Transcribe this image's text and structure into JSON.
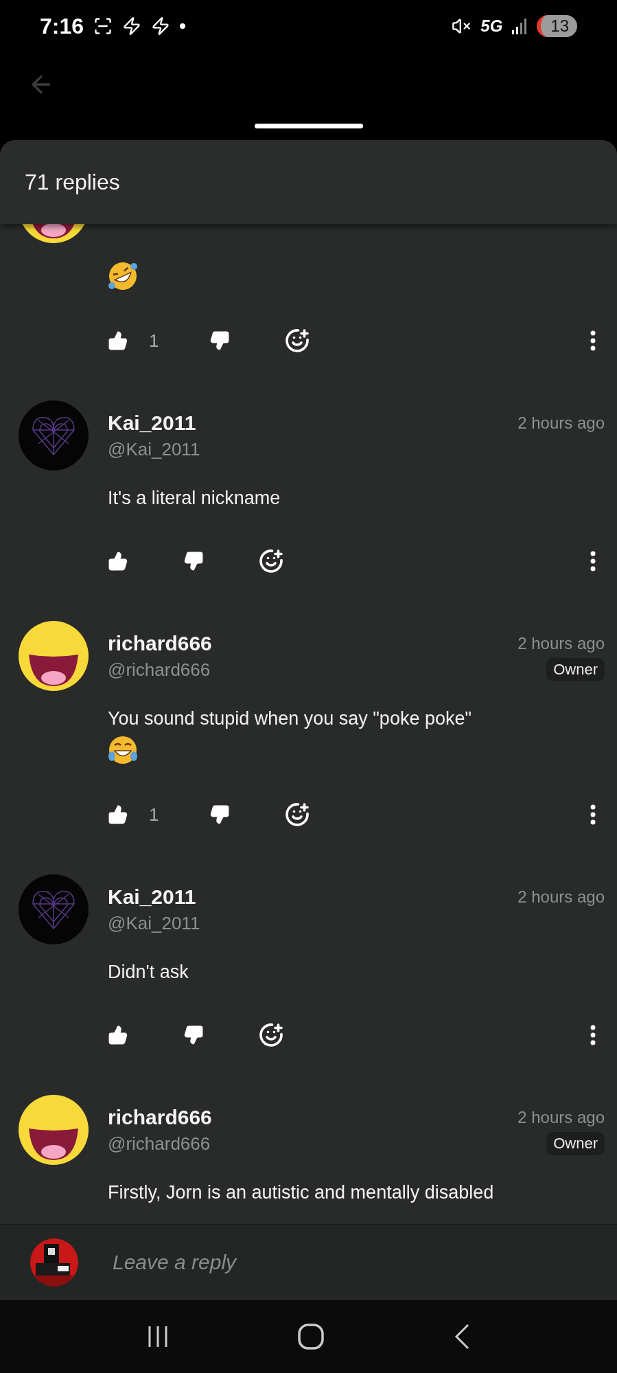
{
  "status_bar": {
    "time": "7:16",
    "network": "5G",
    "battery": "13"
  },
  "sheet": {
    "title": "71 replies"
  },
  "comments": [
    {
      "avatar": {
        "kind": "smiley"
      },
      "emoji": {
        "kind": "rolling"
      },
      "likes": "1"
    },
    {
      "name": "Kai_2011",
      "handle": "@Kai_2011",
      "time": "2 hours ago",
      "avatar": {
        "kind": "web"
      },
      "text": "It's a literal nickname"
    },
    {
      "name": "richard666",
      "handle": "@richard666",
      "time": "2 hours ago",
      "badge": "Owner",
      "avatar": {
        "kind": "smiley"
      },
      "text": "You sound stupid when you say \"poke poke\"",
      "emoji": {
        "kind": "tears"
      },
      "likes": "1"
    },
    {
      "name": "Kai_2011",
      "handle": "@Kai_2011",
      "time": "2 hours ago",
      "avatar": {
        "kind": "web"
      },
      "text": "Didn't ask"
    },
    {
      "name": "richard666",
      "handle": "@richard666",
      "time": "2 hours ago",
      "badge": "Owner",
      "avatar": {
        "kind": "smiley"
      },
      "text": "Firstly, Jorn is an autistic and mentally disabled",
      "cut_off": true
    }
  ],
  "reply_bar": {
    "placeholder": "Leave a reply"
  }
}
